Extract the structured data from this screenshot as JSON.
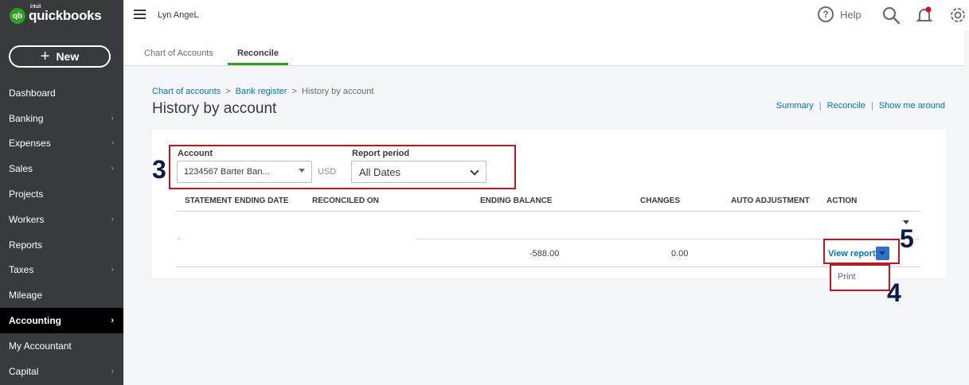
{
  "sidebar": {
    "logo": {
      "mark": "qb",
      "small": "intuit",
      "text": "quickbooks"
    },
    "new_label": "New",
    "items": [
      {
        "label": "Dashboard",
        "chevron": false
      },
      {
        "label": "Banking",
        "chevron": true
      },
      {
        "label": "Expenses",
        "chevron": true
      },
      {
        "label": "Sales",
        "chevron": true
      },
      {
        "label": "Projects",
        "chevron": false
      },
      {
        "label": "Workers",
        "chevron": true
      },
      {
        "label": "Reports",
        "chevron": false
      },
      {
        "label": "Taxes",
        "chevron": true
      },
      {
        "label": "Mileage",
        "chevron": false
      },
      {
        "label": "Accounting",
        "chevron": true,
        "active": true
      },
      {
        "label": "My Accountant",
        "chevron": false
      },
      {
        "label": "Capital",
        "chevron": true
      }
    ]
  },
  "topbar": {
    "company": "Lyn AngeL",
    "help_label": "Help",
    "help_icon": "?",
    "notification_dot_color": "#e10b18"
  },
  "tabs": [
    "Chart of Accounts",
    "Reconcile"
  ],
  "breadcrumb": {
    "items": [
      "Chart of accounts",
      "Bank register",
      "History by account"
    ],
    "separator": ">"
  },
  "page_title": "History by account",
  "top_links": [
    "Summary",
    "Reconcile",
    "Show me around"
  ],
  "filters": {
    "account_label": "Account",
    "account_value": "1234567 Barter Ban...",
    "currency": "USD",
    "period_label": "Report period",
    "period_value": "All Dates"
  },
  "table": {
    "headers": [
      "STATEMENT ENDING DATE",
      "RECONCILED ON",
      "ENDING BALANCE",
      "CHANGES",
      "AUTO ADJUSTMENT",
      "ACTION"
    ],
    "row": {
      "statement_date": "-",
      "ending_balance": "-588.00",
      "changes": "0.00",
      "action": "View report"
    }
  },
  "dropdown": {
    "items": [
      "Print"
    ]
  },
  "annotations": {
    "filters": "3",
    "view_report": "5",
    "print": "4",
    "color": "#c0161f"
  },
  "colors": {
    "sidebar": "#393a3d",
    "accent_green": "#2ca01c",
    "link_blue": "#0077c5"
  }
}
